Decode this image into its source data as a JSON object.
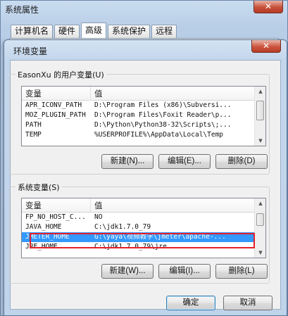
{
  "back_window": {
    "title": "系统属性",
    "close_label": "✕",
    "tabs": [
      {
        "label": "计算机名"
      },
      {
        "label": "硬件"
      },
      {
        "label": "高级"
      },
      {
        "label": "系统保护"
      },
      {
        "label": "远程"
      }
    ]
  },
  "dialog": {
    "title": "环境变量",
    "close_label": "✕",
    "user_group": {
      "label": "EasonXu 的用户变量(U)",
      "col_variable": "变量",
      "col_value": "值",
      "rows": [
        {
          "name": "APR_ICONV_PATH",
          "value": "D:\\Program Files (x86)\\Subversi..."
        },
        {
          "name": "MOZ_PLUGIN_PATH",
          "value": "D:\\Program Files\\Foxit Reader\\p..."
        },
        {
          "name": "PATH",
          "value": "D:\\Python\\Python38-32\\Scripts\\;..."
        },
        {
          "name": "TEMP",
          "value": "%USERPROFILE%\\AppData\\Local\\Temp"
        }
      ],
      "new_btn": "新建(N)...",
      "edit_btn": "编辑(E)...",
      "delete_btn": "删除(D)"
    },
    "system_group": {
      "label": "系统变量(S)",
      "col_variable": "变量",
      "col_value": "值",
      "rows": [
        {
          "name": "FP_NO_HOST_C...",
          "value": "NO"
        },
        {
          "name": "JAVA_HOME",
          "value": "C:\\jdk1.7.0_79"
        },
        {
          "name": "JMETER_HOME",
          "value": "G:\\yaya\\视频教学\\jmeter\\apache-..."
        },
        {
          "name": "JRE_HOME",
          "value": "C:\\jdk1.7.0_79\\jre"
        }
      ],
      "selected_row": "JMETER_HOME",
      "new_btn": "新建(W)...",
      "edit_btn": "编辑(I)...",
      "delete_btn": "删除(L)"
    },
    "ok_btn": "确定",
    "cancel_btn": "取消"
  },
  "colors": {
    "selection": "#3399ff",
    "annotation_box": "#e5202a"
  }
}
